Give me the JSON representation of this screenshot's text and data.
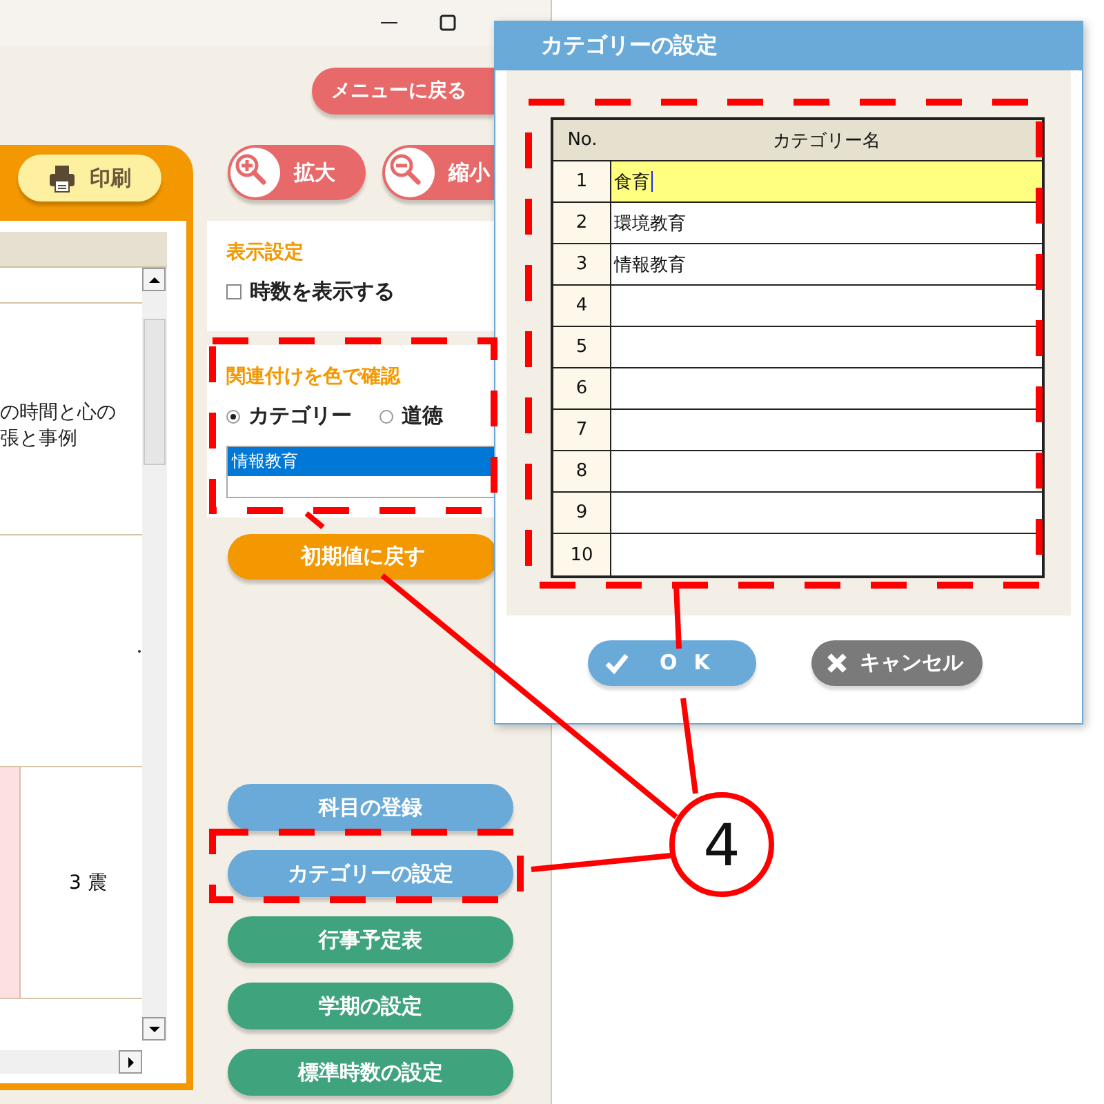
{
  "menu_button": {
    "label": "メニューに戻る"
  },
  "print_button": {
    "label": "印刷"
  },
  "zoom_buttons": [
    {
      "kind": "zoom-in",
      "label": "拡大"
    },
    {
      "kind": "zoom-out",
      "label": "縮小"
    }
  ],
  "schedule": {
    "rows": [
      {
        "kind": "text",
        "lines": [
          "の時間と心の",
          "張と事例"
        ]
      },
      {
        "kind": "blank"
      },
      {
        "kind": "marked",
        "lines": [
          "3 震"
        ]
      }
    ]
  },
  "display_settings": {
    "title": "表示設定",
    "checkbox": {
      "label": "時数を表示する",
      "checked": false
    }
  },
  "link_color": {
    "title": "関連付けを色で確認",
    "options": [
      {
        "label": "カテゴリー",
        "selected": true
      },
      {
        "label": "道徳",
        "selected": false
      }
    ],
    "list": [
      {
        "label": "情報教育",
        "selected": true
      }
    ]
  },
  "reset_button": {
    "label": "初期値に戻す"
  },
  "nav_buttons": [
    {
      "label": "科目の登録",
      "color": "#6aaad8"
    },
    {
      "label": "カテゴリーの設定",
      "color": "#6aaad8"
    },
    {
      "label": "行事予定表",
      "color": "#3fa37e"
    },
    {
      "label": "学期の設定",
      "color": "#3fa37e"
    },
    {
      "label": "標準時数の設定",
      "color": "#3fa37e"
    }
  ],
  "dialog": {
    "title": "カテゴリーの設定",
    "columns": [
      "No.",
      "カテゴリー名"
    ],
    "rows": [
      {
        "no": "1",
        "name": "食育",
        "selected": true
      },
      {
        "no": "2",
        "name": "環境教育",
        "selected": false
      },
      {
        "no": "3",
        "name": "情報教育",
        "selected": false
      },
      {
        "no": "4",
        "selected": false
      },
      {
        "no": "5",
        "selected": false
      },
      {
        "no": "6",
        "selected": false
      },
      {
        "no": "7",
        "selected": false
      },
      {
        "no": "8",
        "selected": false
      },
      {
        "no": "9",
        "selected": false
      },
      {
        "no": "10",
        "selected": false
      }
    ],
    "buttons": [
      {
        "kind": "ok",
        "label": "OK"
      },
      {
        "kind": "cancel",
        "label": "キャンセル"
      }
    ]
  },
  "callout": {
    "label": "4"
  }
}
